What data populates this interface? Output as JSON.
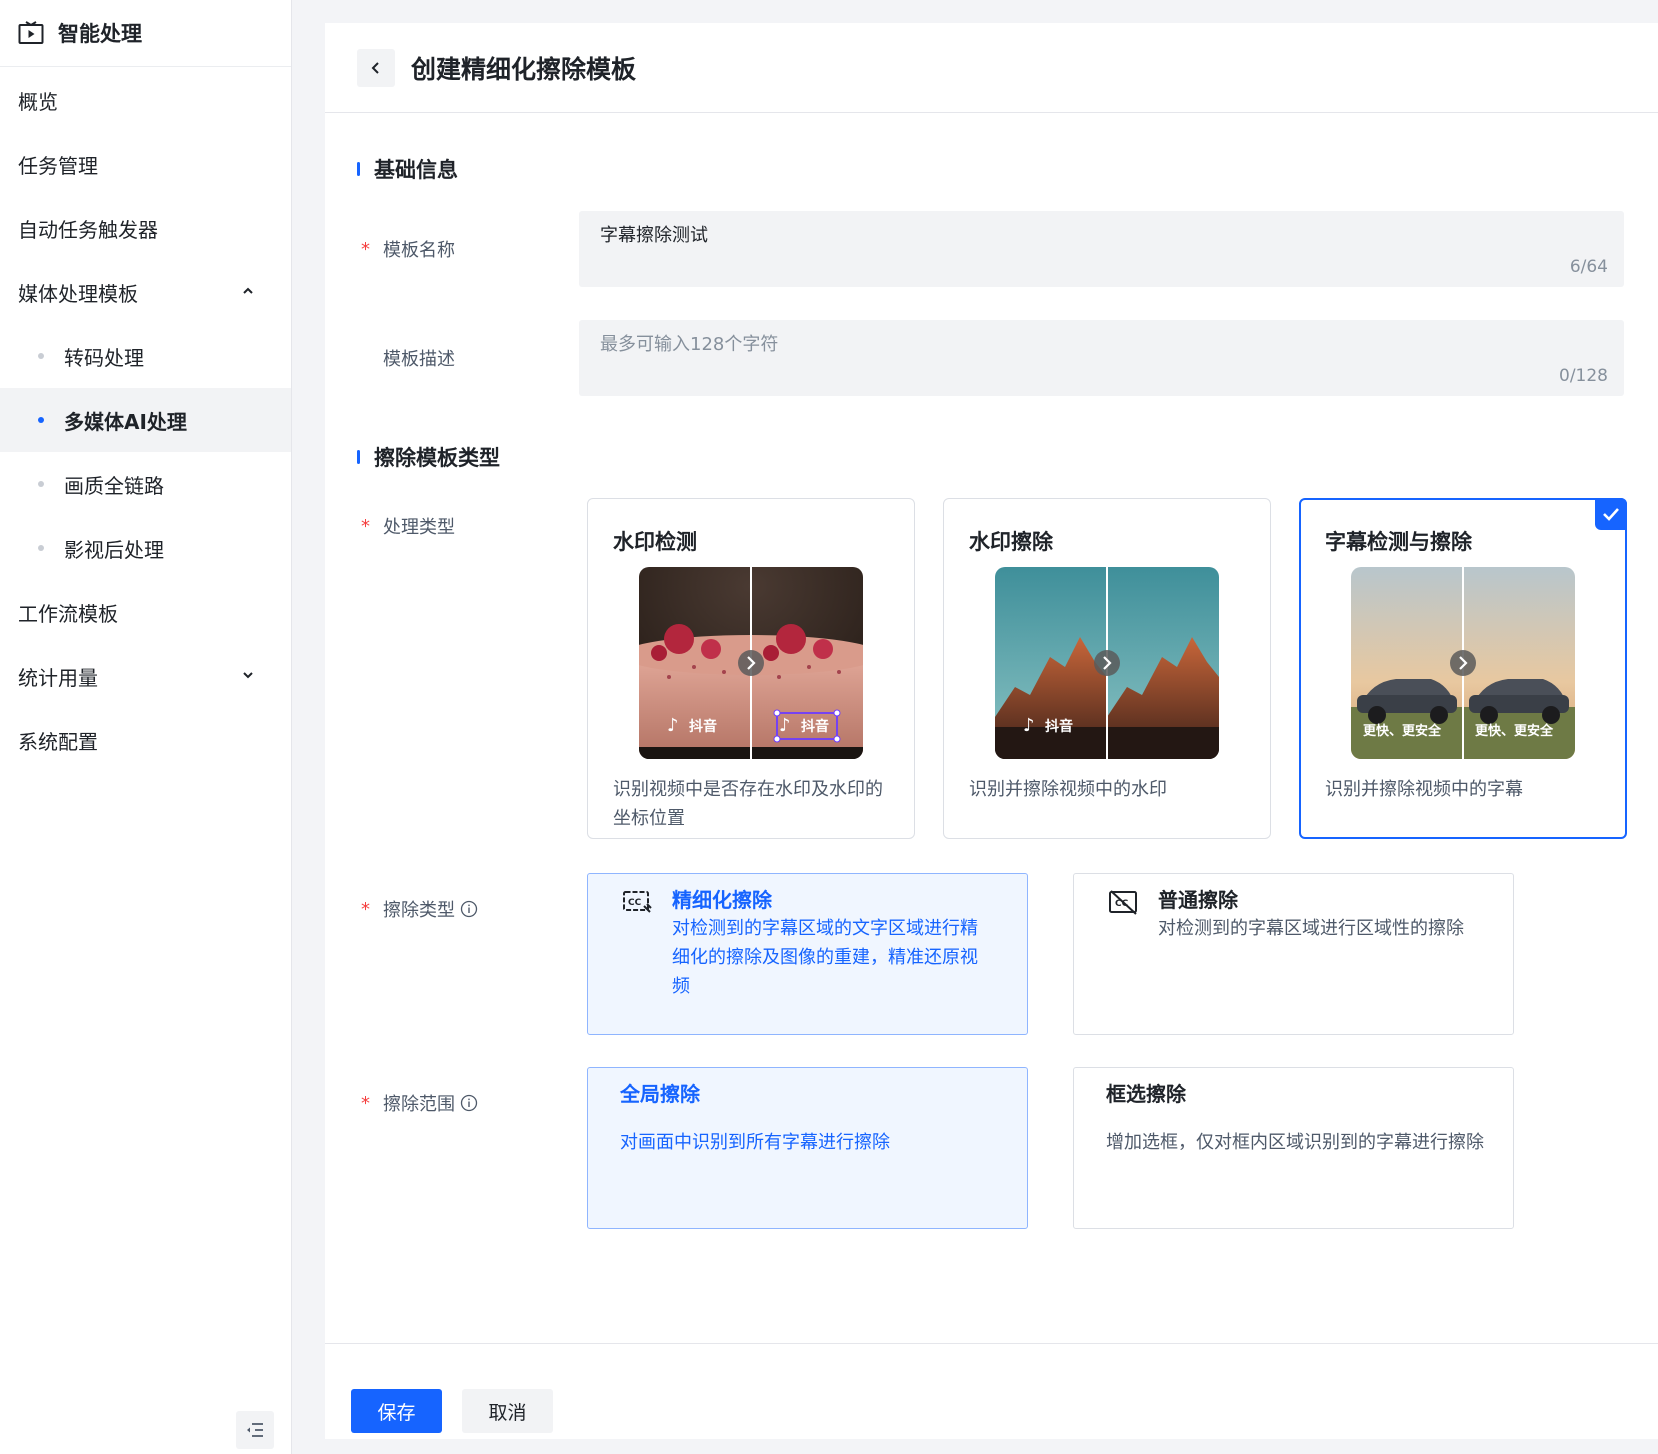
{
  "sidebar": {
    "title": "智能处理",
    "items": [
      {
        "label": "概览"
      },
      {
        "label": "任务管理"
      },
      {
        "label": "自动任务触发器"
      },
      {
        "label": "媒体处理模板"
      },
      {
        "label": "转码处理"
      },
      {
        "label": "多媒体AI处理"
      },
      {
        "label": "画质全链路"
      },
      {
        "label": "影视后处理"
      },
      {
        "label": "工作流模板"
      },
      {
        "label": "统计用量"
      },
      {
        "label": "系统配置"
      }
    ],
    "active_item": "多媒体AI处理"
  },
  "page": {
    "title": "创建精细化擦除模板"
  },
  "basic": {
    "section_title": "基础信息",
    "name_label": "模板名称",
    "name_value": "字幕擦除测试",
    "name_count": "6/64",
    "desc_label": "模板描述",
    "desc_placeholder": "最多可输入128个字符",
    "desc_count": "0/128"
  },
  "erase_type_section": {
    "section_title": "擦除模板类型",
    "process_label": "处理类型",
    "process_types": [
      {
        "title": "水印检测",
        "desc": "识别视频中是否存在水印及水印的坐标位置",
        "watermark_text": "抖音"
      },
      {
        "title": "水印擦除",
        "desc": "识别并擦除视频中的水印",
        "watermark_text": "抖音"
      },
      {
        "title": "字幕检测与擦除",
        "desc": "识别并擦除视频中的字幕",
        "caption_text": "更快、更安全",
        "selected": true
      }
    ],
    "erase_label": "擦除类型",
    "erase_options": [
      {
        "title": "精细化擦除",
        "desc": "对检测到的字幕区域的文字区域进行精细化的擦除及图像的重建，精准还原视频",
        "selected": true
      },
      {
        "title": "普通擦除",
        "desc": "对检测到的字幕区域进行区域性的擦除"
      }
    ],
    "range_label": "擦除范围",
    "range_options": [
      {
        "title": "全局擦除",
        "desc": "对画面中识别到所有字幕进行擦除",
        "selected": true
      },
      {
        "title": "框选擦除",
        "desc": "增加选框，仅对框内区域识别到的字幕进行擦除"
      }
    ]
  },
  "footer": {
    "save_label": "保存",
    "cancel_label": "取消"
  },
  "colors": {
    "accent": "#1664ff",
    "required": "#f53f3f",
    "selected_bg": "#f0f6ff"
  }
}
